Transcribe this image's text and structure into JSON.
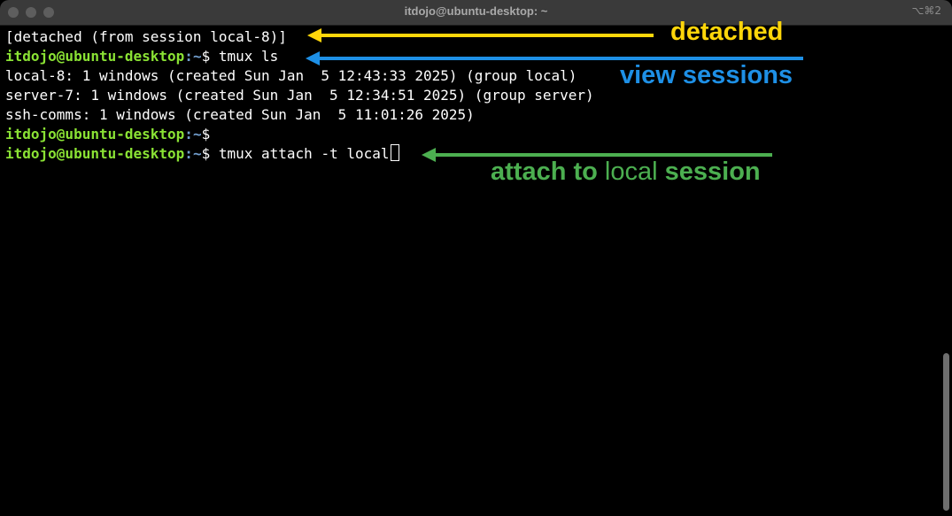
{
  "window": {
    "title": "itdojo@ubuntu-desktop: ~",
    "shortcut": "⌥⌘2"
  },
  "prompt": {
    "user_host": "itdojo@ubuntu-desktop",
    "separator": ":",
    "path": "~",
    "symbol": "$"
  },
  "terminal": {
    "lines": [
      {
        "text": "[detached (from session local-8)]"
      },
      {
        "command": " tmux ls"
      },
      {
        "text": "local-8: 1 windows (created Sun Jan  5 12:43:33 2025) (group local)"
      },
      {
        "text": "server-7: 1 windows (created Sun Jan  5 12:34:51 2025) (group server)"
      },
      {
        "text": "ssh-comms: 1 windows (created Sun Jan  5 11:01:26 2025)"
      },
      {
        "command": ""
      },
      {
        "command": " tmux attach -t local"
      }
    ]
  },
  "annotations": {
    "detached": {
      "label": "detached",
      "color": "#ffd60a"
    },
    "view_sessions": {
      "label": "view sessions",
      "color": "#1e90e6"
    },
    "attach": {
      "label_pre": "attach to ",
      "label_mid": "local",
      "label_post": " session",
      "color": "#4caf50"
    }
  },
  "colors": {
    "background": "#000000",
    "titlebar": "#3a3a3a",
    "prompt_user": "#8ae234",
    "prompt_path": "#729fcf",
    "text": "#ffffff"
  }
}
